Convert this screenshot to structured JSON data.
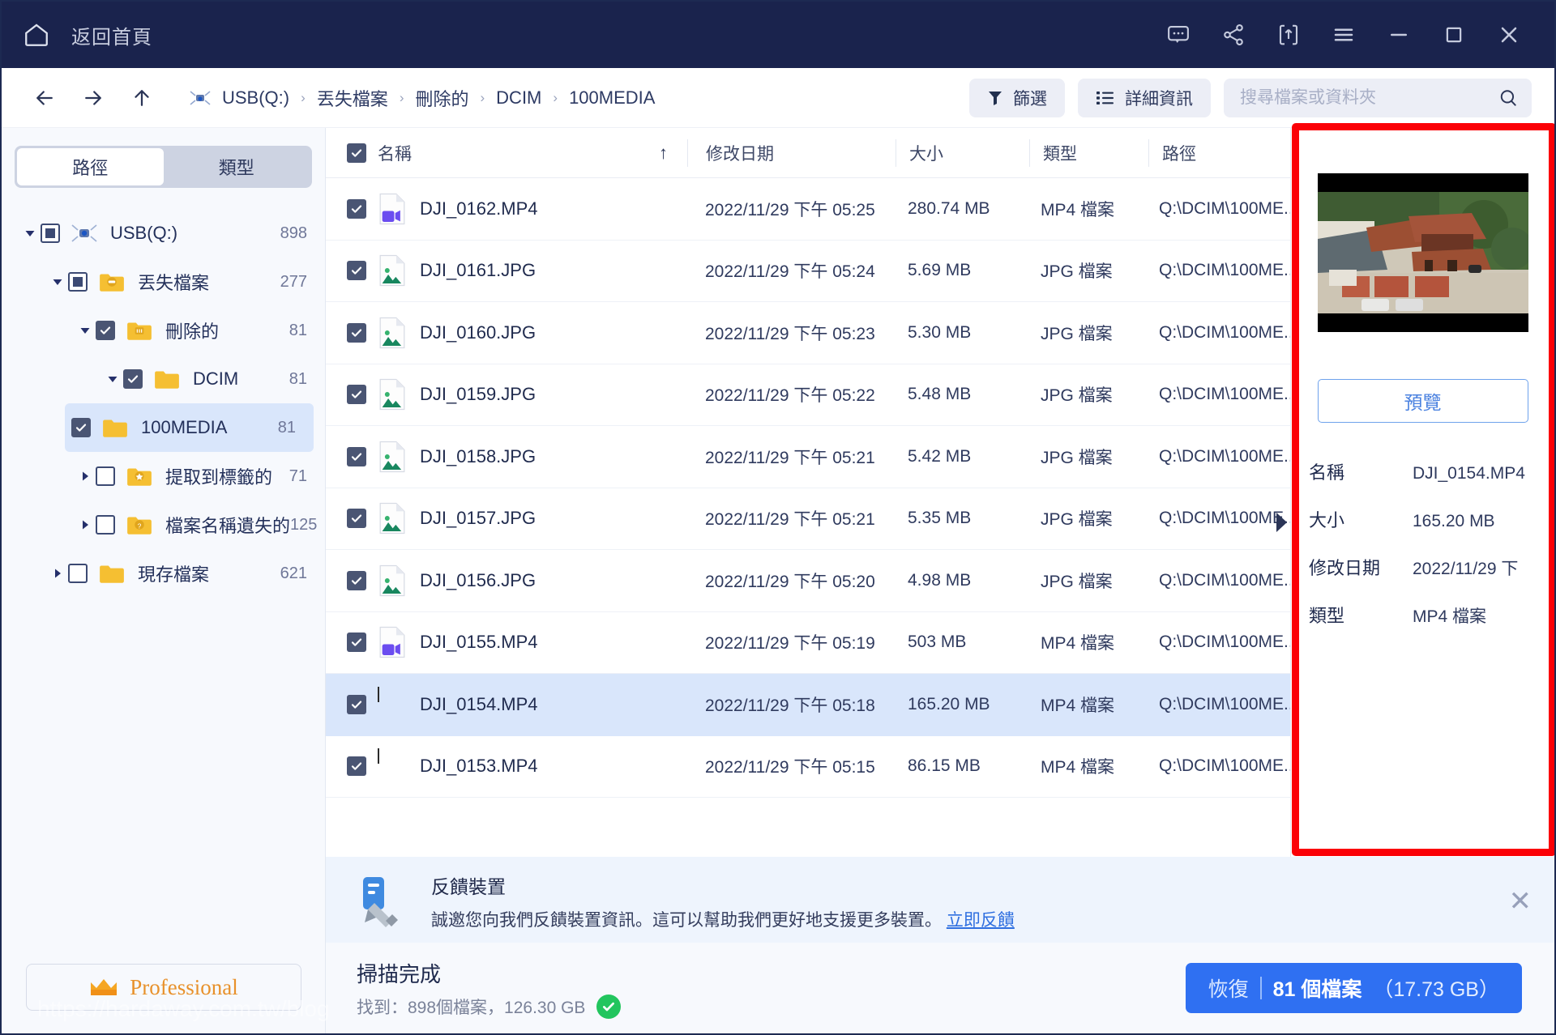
{
  "titlebar": {
    "home_label": "返回首頁",
    "icons": [
      "chat-icon",
      "share-icon",
      "upload-icon",
      "menu-icon",
      "minimize-icon",
      "maximize-icon",
      "close-icon"
    ]
  },
  "navbar": {
    "back": "back-arrow-icon",
    "forward": "forward-arrow-icon",
    "up": "up-arrow-icon",
    "breadcrumb": [
      "USB(Q:)",
      "丟失檔案",
      "刪除的",
      "DCIM",
      "100MEDIA"
    ],
    "separator": "›",
    "filter_label": "篩選",
    "details_label": "詳細資訊",
    "search_placeholder": "搜尋檔案或資料夾",
    "search_value": ""
  },
  "sidebar": {
    "tabs": [
      {
        "label": "路徑",
        "active": true
      },
      {
        "label": "類型",
        "active": false
      }
    ],
    "tree": [
      {
        "label": "USB(Q:)",
        "count": "898",
        "depth": 0,
        "check": "partial",
        "icon": "drone-icon",
        "expanded": true,
        "selected": false,
        "twisty": "down"
      },
      {
        "label": "丟失檔案",
        "count": "277",
        "depth": 1,
        "check": "partial",
        "icon": "folder-lost-icon",
        "expanded": true,
        "selected": false,
        "twisty": "down"
      },
      {
        "label": "刪除的",
        "count": "81",
        "depth": 2,
        "check": "checked",
        "icon": "folder-trash-icon",
        "expanded": true,
        "selected": false,
        "twisty": "down"
      },
      {
        "label": "DCIM",
        "count": "81",
        "depth": 3,
        "check": "checked",
        "icon": "folder-icon",
        "expanded": true,
        "selected": false,
        "twisty": "down"
      },
      {
        "label": "100MEDIA",
        "count": "81",
        "depth": 4,
        "check": "checked",
        "icon": "folder-icon",
        "expanded": false,
        "selected": true,
        "twisty": "none"
      },
      {
        "label": "提取到標籤的",
        "count": "71",
        "depth": 2,
        "check": "empty",
        "icon": "folder-tag-icon",
        "expanded": false,
        "selected": false,
        "twisty": "right"
      },
      {
        "label": "檔案名稱遺失的",
        "count": "125",
        "depth": 2,
        "check": "empty",
        "icon": "folder-unknown-icon",
        "expanded": false,
        "selected": false,
        "twisty": "right"
      },
      {
        "label": "現存檔案",
        "count": "621",
        "depth": 1,
        "check": "empty",
        "icon": "folder-icon",
        "expanded": false,
        "selected": false,
        "twisty": "right"
      }
    ],
    "pro_label": "Professional"
  },
  "table": {
    "headers": {
      "name": "名稱",
      "date": "修改日期",
      "size": "大小",
      "type": "類型",
      "path": "路徑"
    },
    "sort_indicator": "↑",
    "rows": [
      {
        "name": "DJI_0153.MP4",
        "date": "2022/11/29 下午 05:15",
        "size": "86.15 MB",
        "type": "MP4 檔案",
        "path": "Q:\\DCIM\\100ME...",
        "icon": "thumbnail",
        "checked": true,
        "selected": false
      },
      {
        "name": "DJI_0154.MP4",
        "date": "2022/11/29 下午 05:18",
        "size": "165.20 MB",
        "type": "MP4 檔案",
        "path": "Q:\\DCIM\\100ME...",
        "icon": "thumbnail",
        "checked": true,
        "selected": true
      },
      {
        "name": "DJI_0155.MP4",
        "date": "2022/11/29 下午 05:19",
        "size": "503 MB",
        "type": "MP4 檔案",
        "path": "Q:\\DCIM\\100ME...",
        "icon": "video",
        "checked": true,
        "selected": false
      },
      {
        "name": "DJI_0156.JPG",
        "date": "2022/11/29 下午 05:20",
        "size": "4.98 MB",
        "type": "JPG 檔案",
        "path": "Q:\\DCIM\\100ME...",
        "icon": "image",
        "checked": true,
        "selected": false
      },
      {
        "name": "DJI_0157.JPG",
        "date": "2022/11/29 下午 05:21",
        "size": "5.35 MB",
        "type": "JPG 檔案",
        "path": "Q:\\DCIM\\100ME...",
        "icon": "image",
        "checked": true,
        "selected": false
      },
      {
        "name": "DJI_0158.JPG",
        "date": "2022/11/29 下午 05:21",
        "size": "5.42 MB",
        "type": "JPG 檔案",
        "path": "Q:\\DCIM\\100ME...",
        "icon": "image",
        "checked": true,
        "selected": false
      },
      {
        "name": "DJI_0159.JPG",
        "date": "2022/11/29 下午 05:22",
        "size": "5.48 MB",
        "type": "JPG 檔案",
        "path": "Q:\\DCIM\\100ME...",
        "icon": "image",
        "checked": true,
        "selected": false
      },
      {
        "name": "DJI_0160.JPG",
        "date": "2022/11/29 下午 05:23",
        "size": "5.30 MB",
        "type": "JPG 檔案",
        "path": "Q:\\DCIM\\100ME...",
        "icon": "image",
        "checked": true,
        "selected": false
      },
      {
        "name": "DJI_0161.JPG",
        "date": "2022/11/29 下午 05:24",
        "size": "5.69 MB",
        "type": "JPG 檔案",
        "path": "Q:\\DCIM\\100ME...",
        "icon": "image",
        "checked": true,
        "selected": false
      },
      {
        "name": "DJI_0162.MP4",
        "date": "2022/11/29 下午 05:25",
        "size": "280.74 MB",
        "type": "MP4 檔案",
        "path": "Q:\\DCIM\\100ME...",
        "icon": "video",
        "checked": true,
        "selected": false
      }
    ]
  },
  "preview": {
    "button_label": "預覽",
    "meta": [
      {
        "key": "名稱",
        "value": "DJI_0154.MP4"
      },
      {
        "key": "大小",
        "value": "165.20 MB"
      },
      {
        "key": "修改日期",
        "value": "2022/11/29 下"
      },
      {
        "key": "類型",
        "value": "MP4 檔案"
      }
    ]
  },
  "banner": {
    "title": "反饋裝置",
    "body": "誠邀您向我們反饋裝置資訊。這可以幫助我們更好地支援更多裝置。",
    "link": "立即反饋",
    "close": "✕"
  },
  "footer": {
    "scan_title": "掃描完成",
    "scan_sub": "找到：898個檔案，126.30 GB",
    "recover_main": "恢復",
    "recover_count": "81 個檔案",
    "recover_size": "（17.73 GB）"
  },
  "watermark": "https://hardaway.com.tw/blog",
  "colors": {
    "titlebar": "#1a234d",
    "accent": "#2f70f2",
    "selection": "#d9e6fb",
    "annotation": "#fb0007",
    "success": "#22c55e",
    "pro": "#e8912b"
  }
}
